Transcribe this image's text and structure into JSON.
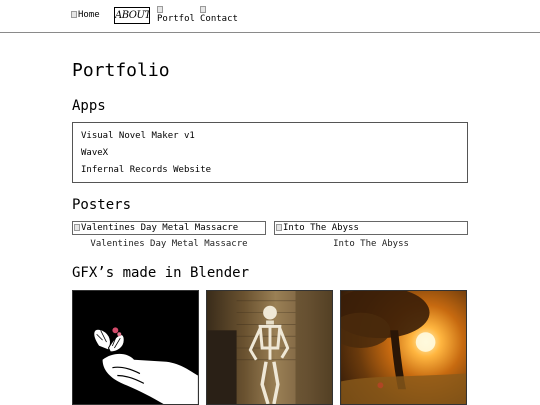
{
  "nav": {
    "home": "Home",
    "about": "ABOUT",
    "portfolio": "Portfolio",
    "contact": "Contact"
  },
  "page_title": "Portfolio",
  "apps": {
    "heading": "Apps",
    "items": [
      "Visual Novel Maker v1",
      "WaveX",
      "Infernal Records Website"
    ]
  },
  "posters": {
    "heading": "Posters",
    "items": [
      {
        "alt": "Valentines Day Metal Massacre",
        "caption": "Valentines Day Metal Massacre"
      },
      {
        "alt": "Into The Abyss",
        "caption": "Into The Abyss"
      }
    ]
  },
  "gfx": {
    "heading": "GFX’s made in Blender",
    "images": [
      {
        "subject": "hand-with-butterfly-artwork"
      },
      {
        "subject": "skeleton-in-doorway-artwork"
      },
      {
        "subject": "sunlit-tree-landscape-artwork"
      }
    ]
  }
}
